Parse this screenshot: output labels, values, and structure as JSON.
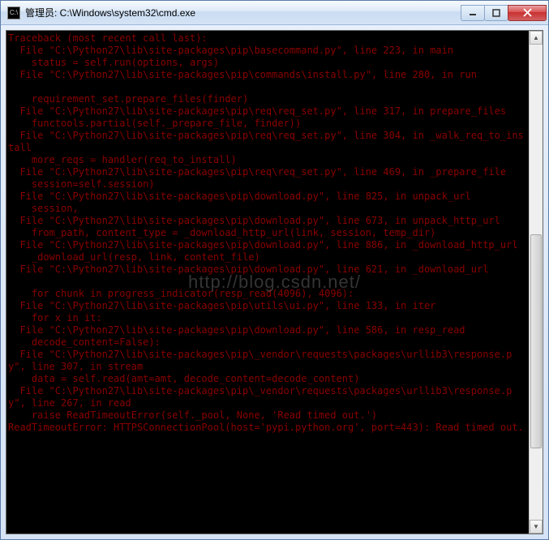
{
  "window": {
    "icon_hint": "cmd-icon",
    "title": "管理员: C:\\Windows\\system32\\cmd.exe"
  },
  "watermark": "http://blog.csdn.net/",
  "terminal": {
    "lines": [
      "Traceback (most recent call last):",
      "  File \"C:\\Python27\\lib\\site-packages\\pip\\basecommand.py\", line 223, in main",
      "    status = self.run(options, args)",
      "  File \"C:\\Python27\\lib\\site-packages\\pip\\commands\\install.py\", line 280, in run",
      "",
      "    requirement_set.prepare_files(finder)",
      "  File \"C:\\Python27\\lib\\site-packages\\pip\\req\\req_set.py\", line 317, in prepare_files",
      "    functools.partial(self._prepare_file, finder))",
      "  File \"C:\\Python27\\lib\\site-packages\\pip\\req\\req_set.py\", line 304, in _walk_req_to_install",
      "    more_reqs = handler(req_to_install)",
      "  File \"C:\\Python27\\lib\\site-packages\\pip\\req\\req_set.py\", line 469, in _prepare_file",
      "    session=self.session)",
      "  File \"C:\\Python27\\lib\\site-packages\\pip\\download.py\", line 825, in unpack_url",
      "    session,",
      "  File \"C:\\Python27\\lib\\site-packages\\pip\\download.py\", line 673, in unpack_http_url",
      "    from_path, content_type = _download_http_url(link, session, temp_dir)",
      "  File \"C:\\Python27\\lib\\site-packages\\pip\\download.py\", line 886, in _download_http_url",
      "    _download_url(resp, link, content_file)",
      "  File \"C:\\Python27\\lib\\site-packages\\pip\\download.py\", line 621, in _download_url",
      "",
      "    for chunk in progress_indicator(resp_read(4096), 4096):",
      "  File \"C:\\Python27\\lib\\site-packages\\pip\\utils\\ui.py\", line 133, in iter",
      "    for x in it:",
      "  File \"C:\\Python27\\lib\\site-packages\\pip\\download.py\", line 586, in resp_read",
      "    decode_content=False):",
      "  File \"C:\\Python27\\lib\\site-packages\\pip\\_vendor\\requests\\packages\\urllib3\\response.py\", line 307, in stream",
      "    data = self.read(amt=amt, decode_content=decode_content)",
      "  File \"C:\\Python27\\lib\\site-packages\\pip\\_vendor\\requests\\packages\\urllib3\\response.py\", line 267, in read",
      "    raise ReadTimeoutError(self._pool, None, 'Read timed out.')",
      "ReadTimeoutError: HTTPSConnectionPool(host='pypi.python.org', port=443): Read timed out."
    ]
  }
}
